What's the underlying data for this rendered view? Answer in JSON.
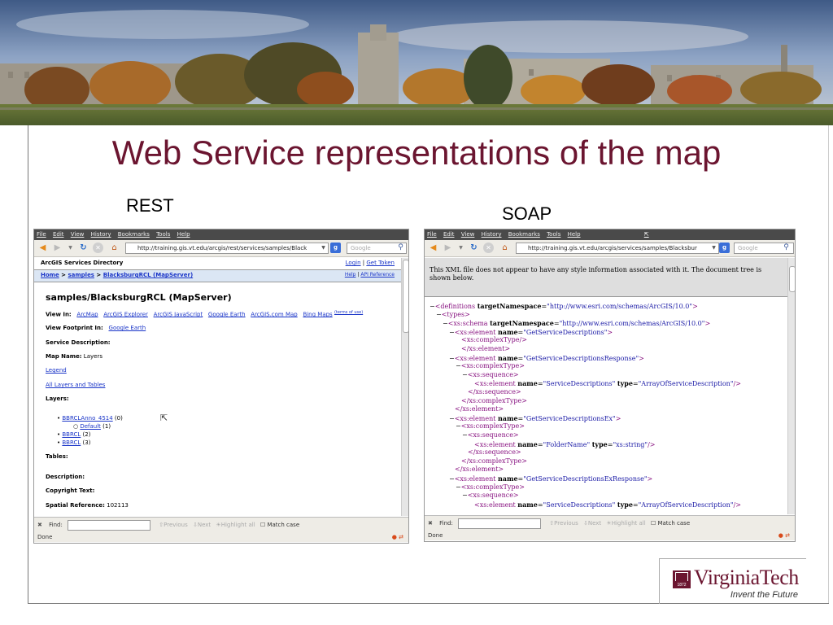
{
  "slide": {
    "title": "Web Service representations of the map",
    "rest_label": "REST",
    "soap_label": "SOAP"
  },
  "browser": {
    "menu": [
      "File",
      "Edit",
      "View",
      "History",
      "Bookmarks",
      "Tools",
      "Help"
    ],
    "search_placeholder": "Google",
    "find_label": "Find:",
    "find_previous": "Previous",
    "find_next": "Next",
    "find_highlight": "Highlight all",
    "find_matchcase": "Match case",
    "status": "Done"
  },
  "rest": {
    "url": "http://training.gis.vt.edu/arcgis/rest/services/samples/Black",
    "directory_title": "ArcGIS Services Directory",
    "login": "Login",
    "sep": "|",
    "get_token": "Get Token",
    "crumb_home": "Home",
    "crumb_gt": ">",
    "crumb_samples": "samples",
    "crumb_service": "BlacksburgRCL (MapServer)",
    "help": "Help",
    "api_reference": "API Reference",
    "heading": "samples/BlacksburgRCL (MapServer)",
    "view_in_label": "View In:",
    "view_in_links": [
      "ArcMap",
      "ArcGIS Explorer",
      "ArcGIS JavaScript",
      "Google Earth",
      "ArcGIS.com Map",
      "Bing Maps"
    ],
    "terms_of_use": "(terms of use)",
    "footprint_label": "View Footprint In:",
    "footprint_link": "Google Earth",
    "service_desc_label": "Service Description:",
    "map_name_label": "Map Name:",
    "map_name_value": "Layers",
    "legend": "Legend",
    "all_layers": "All Layers and Tables",
    "layers_label": "Layers:",
    "layers": [
      {
        "name": "BBRCLAnno_4514",
        "id": "(0)"
      },
      {
        "name": "Default",
        "id": "(1)"
      },
      {
        "name": "BBRCL",
        "id": "(2)"
      },
      {
        "name": "BBRCL",
        "id": "(3)"
      }
    ],
    "tables_label": "Tables:",
    "description_label": "Description:",
    "copyright_label": "Copyright Text:",
    "spatial_ref_label": "Spatial Reference:",
    "spatial_ref_value": "102113"
  },
  "soap": {
    "url": "http://training.gis.vt.edu/arcgis/services/samples/Blacksbur",
    "notice": "This XML file does not appear to have any style information associated with it. The document tree is shown below.",
    "xml_lines": [
      {
        "minus": "−",
        "tag": "<definitions",
        "attr": "targetNamespace",
        "val": "\"http://www.esri.com/schemas/ArcGIS/10.0\"",
        "close": ">"
      },
      {
        "minus": "−",
        "tag": "<types>",
        "attr": "",
        "val": "",
        "close": ""
      },
      {
        "minus": "−",
        "tag": "<xs:schema",
        "attr": "targetNamespace",
        "val": "\"http://www.esri.com/schemas/ArcGIS/10.0\"",
        "close": ">"
      },
      {
        "minus": "−",
        "tag": "<xs:element",
        "attr": "name",
        "val": "\"GetServiceDescriptions\"",
        "close": ">"
      },
      {
        "minus": "",
        "tag": "<xs:complexType/>",
        "attr": "",
        "val": "",
        "close": ""
      },
      {
        "minus": "",
        "tag": "</xs:element>",
        "attr": "",
        "val": "",
        "close": ""
      },
      {
        "minus": "−",
        "tag": "<xs:element",
        "attr": "name",
        "val": "\"GetServiceDescriptionsResponse\"",
        "close": ">"
      },
      {
        "minus": "−",
        "tag": "<xs:complexType>",
        "attr": "",
        "val": "",
        "close": ""
      },
      {
        "minus": "−",
        "tag": "<xs:sequence>",
        "attr": "",
        "val": "",
        "close": ""
      },
      {
        "minus": "",
        "tag": "<xs:element",
        "attr": "name",
        "val": "\"ServiceDescriptions\"",
        "attr2": "type",
        "val2": "\"ArrayOfServiceDescription\"",
        "close": "/>"
      },
      {
        "minus": "",
        "tag": "</xs:sequence>",
        "attr": "",
        "val": "",
        "close": ""
      },
      {
        "minus": "",
        "tag": "</xs:complexType>",
        "attr": "",
        "val": "",
        "close": ""
      },
      {
        "minus": "",
        "tag": "</xs:element>",
        "attr": "",
        "val": "",
        "close": ""
      },
      {
        "minus": "−",
        "tag": "<xs:element",
        "attr": "name",
        "val": "\"GetServiceDescriptionsEx\"",
        "close": ">"
      },
      {
        "minus": "−",
        "tag": "<xs:complexType>",
        "attr": "",
        "val": "",
        "close": ""
      },
      {
        "minus": "−",
        "tag": "<xs:sequence>",
        "attr": "",
        "val": "",
        "close": ""
      },
      {
        "minus": "",
        "tag": "<xs:element",
        "attr": "name",
        "val": "\"FolderName\"",
        "attr2": "type",
        "val2": "\"xs:string\"",
        "close": "/>"
      },
      {
        "minus": "",
        "tag": "</xs:sequence>",
        "attr": "",
        "val": "",
        "close": ""
      },
      {
        "minus": "",
        "tag": "</xs:complexType>",
        "attr": "",
        "val": "",
        "close": ""
      },
      {
        "minus": "",
        "tag": "</xs:element>",
        "attr": "",
        "val": "",
        "close": ""
      },
      {
        "minus": "−",
        "tag": "<xs:element",
        "attr": "name",
        "val": "\"GetServiceDescriptionsExResponse\"",
        "close": ">"
      },
      {
        "minus": "−",
        "tag": "<xs:complexType>",
        "attr": "",
        "val": "",
        "close": ""
      },
      {
        "minus": "−",
        "tag": "<xs:sequence>",
        "attr": "",
        "val": "",
        "close": ""
      },
      {
        "minus": "",
        "tag": "<xs:element",
        "attr": "name",
        "val": "\"ServiceDescriptions\"",
        "attr2": "type",
        "val2": "\"ArrayOfServiceDescription\"",
        "close": "/>"
      }
    ]
  },
  "logo": {
    "name": "VirginiaTech",
    "tagline": "Invent the Future",
    "year": "1872"
  },
  "colors": {
    "title": "#6b1530",
    "vt_maroon": "#6b1530",
    "link": "#1a35c8"
  }
}
